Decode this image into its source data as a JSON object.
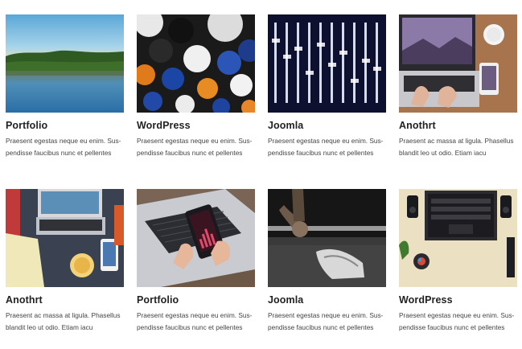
{
  "cards": [
    {
      "title": "Portfolio",
      "desc_line1": "Praesent egestas neque eu enim. Sus-",
      "desc_line2": "pendisse faucibus nunc et pellentes",
      "image_subject": "lake-landscape"
    },
    {
      "title": "WordPress",
      "desc_line1": "Praesent egestas neque eu enim. Sus-",
      "desc_line2": "pendisse faucibus nunc et pellentes",
      "image_subject": "colored-balls"
    },
    {
      "title": "Joomla",
      "desc_line1": "Praesent egestas neque eu enim. Sus-",
      "desc_line2": "pendisse faucibus nunc et pellentes",
      "image_subject": "mixing-console"
    },
    {
      "title": "Anothrt",
      "desc_line1": "Praesent ac massa at ligula. Phasellus",
      "desc_line2": "blandit leo ut odio. Etiam iacu",
      "image_subject": "laptop-desk"
    },
    {
      "title": "Anothrt",
      "desc_line1": "Praesent ac massa at ligula. Phasellus",
      "desc_line2": "blandit leo ut odio. Etiam iacu",
      "image_subject": "workspace-phone"
    },
    {
      "title": "Portfolio",
      "desc_line1": "Praesent egestas neque eu enim. Sus-",
      "desc_line2": "pendisse faucibus nunc et pellentes",
      "image_subject": "smartphone-keyboard"
    },
    {
      "title": "Joomla",
      "desc_line1": "Praesent egestas neque eu enim. Sus-",
      "desc_line2": "pendisse faucibus nunc et pellentes",
      "image_subject": "barbell-gym"
    },
    {
      "title": "WordPress",
      "desc_line1": "Praesent egestas neque eu enim. Sus-",
      "desc_line2": "pendisse faucibus nunc et pellentes",
      "image_subject": "laptop-top-view"
    }
  ]
}
